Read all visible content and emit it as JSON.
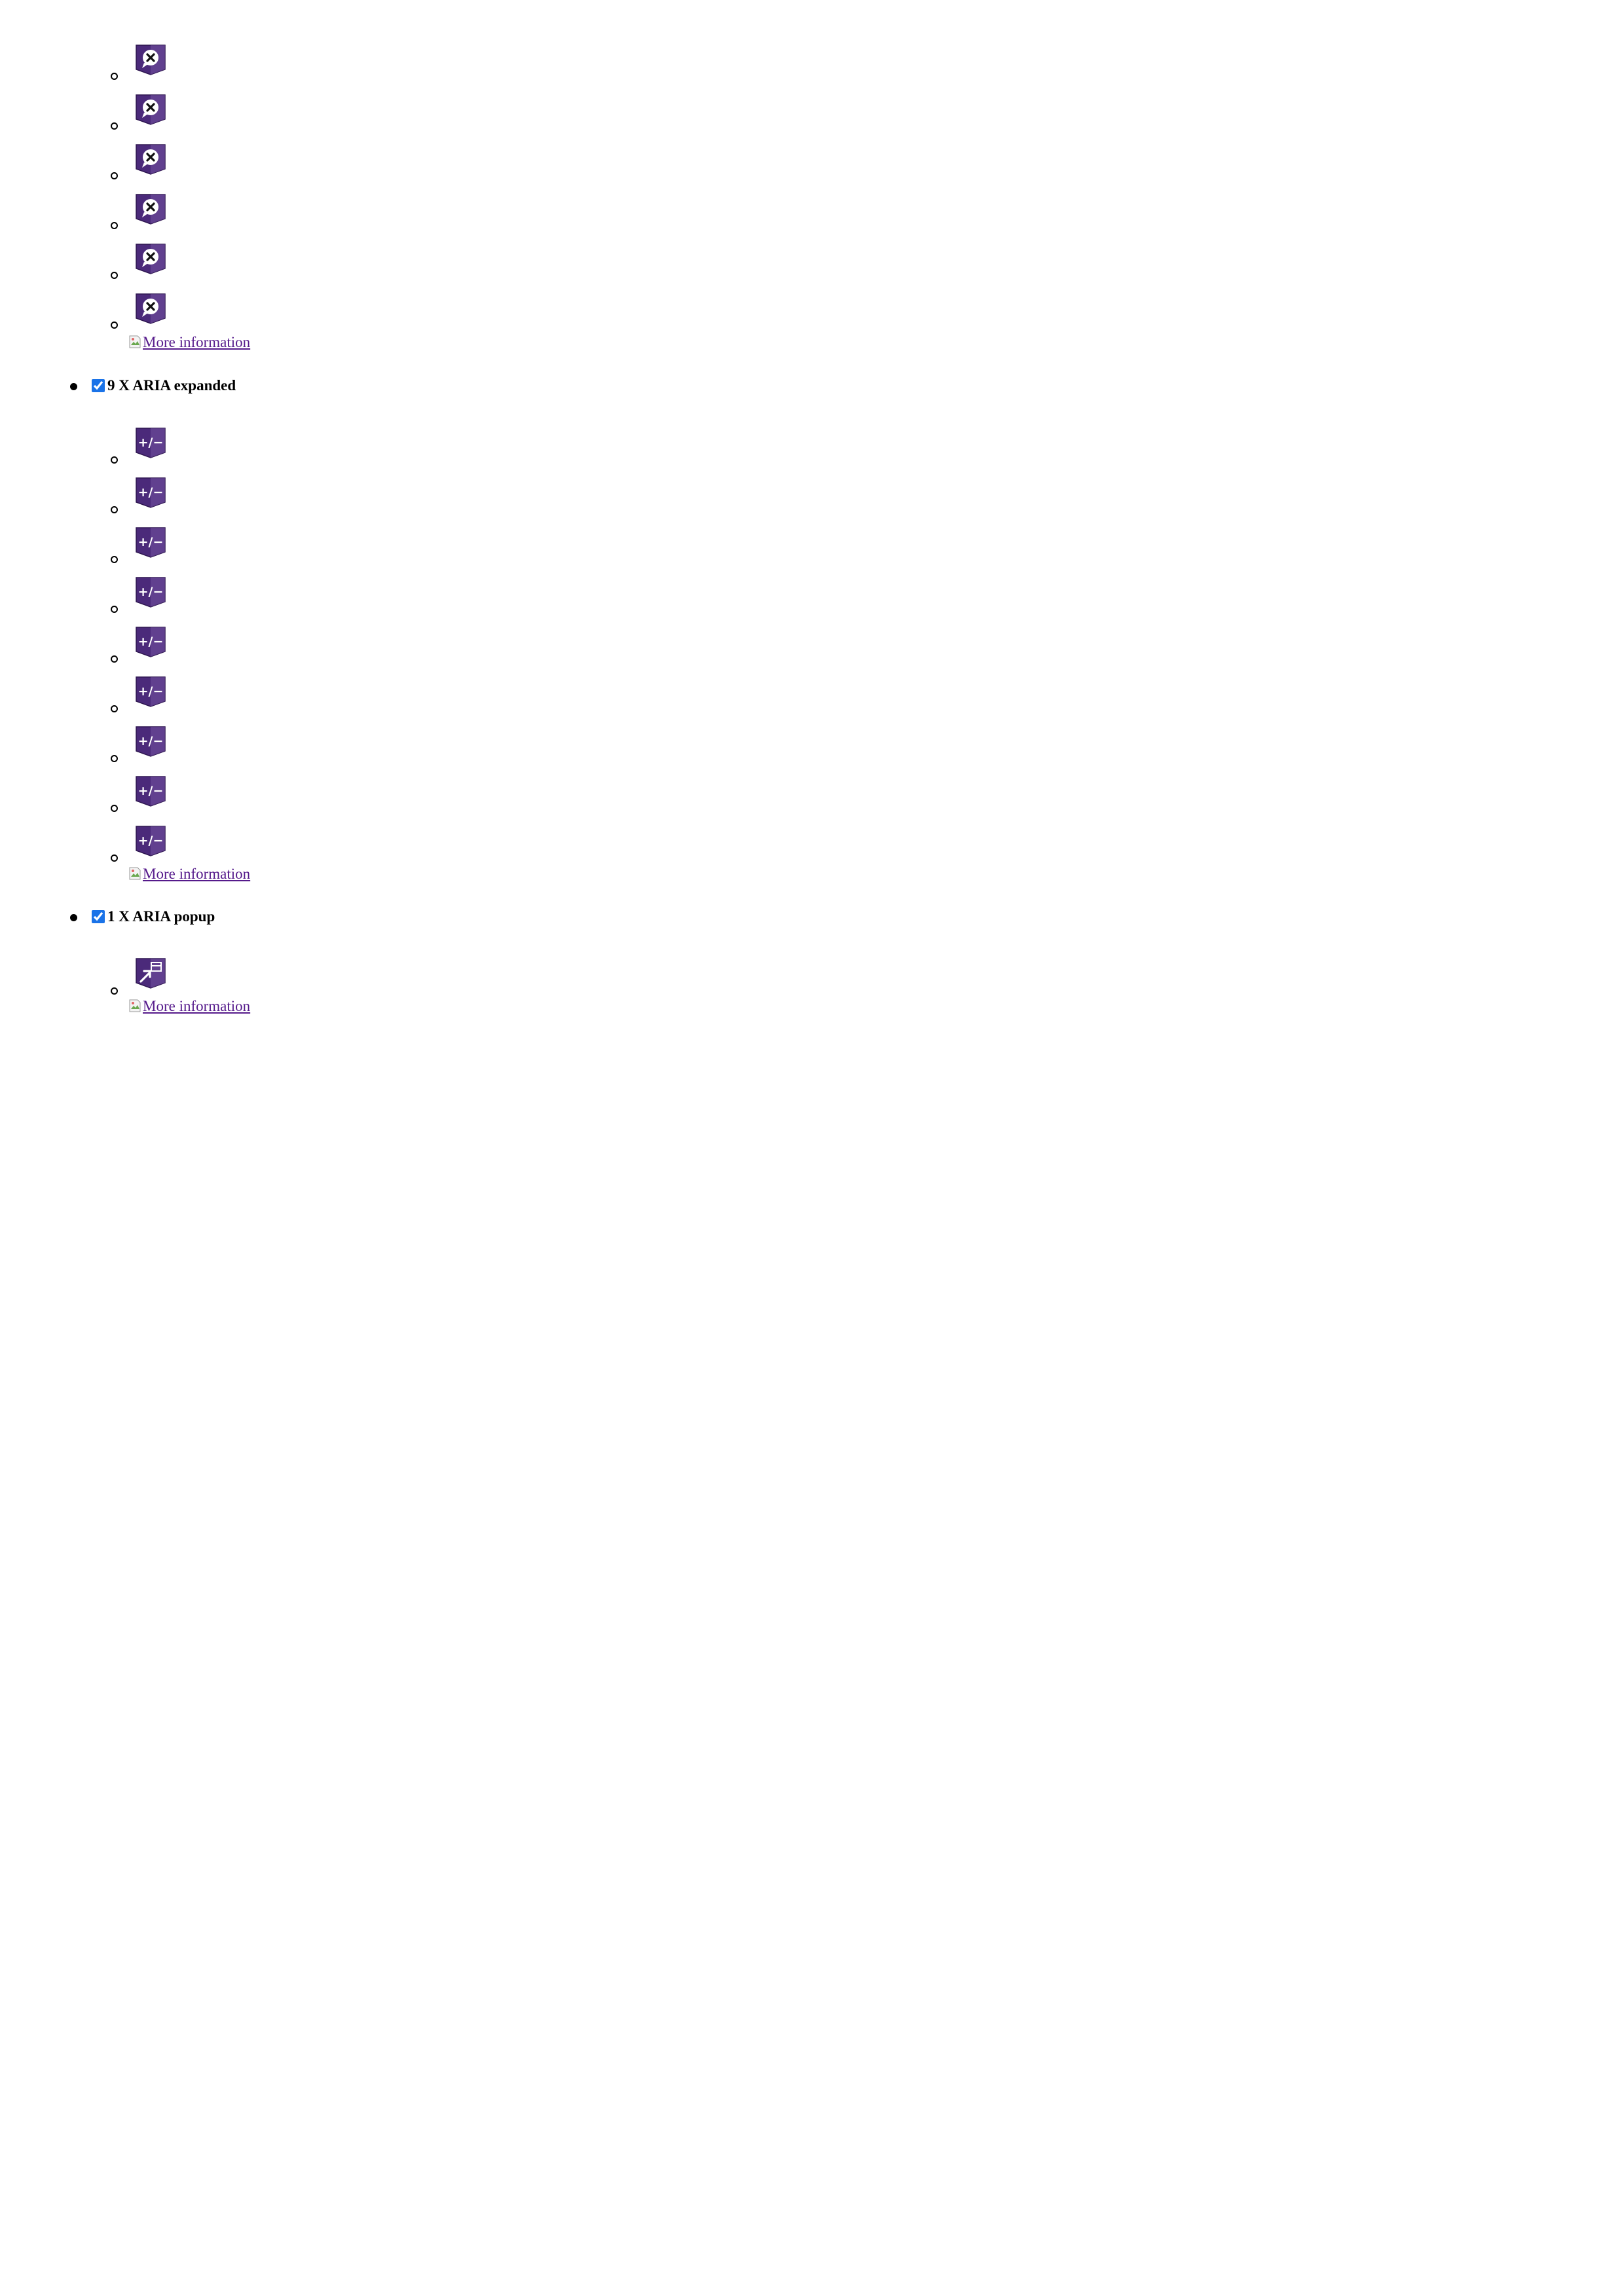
{
  "sections": [
    {
      "heading": "",
      "checked": null,
      "item_icon": "purple-alert-x-icon",
      "item_count": 6,
      "more_link": "More information"
    },
    {
      "heading": "9 X ARIA expanded",
      "checked": true,
      "item_icon": "purple-plus-minus-icon",
      "item_count": 9,
      "more_link": "More information"
    },
    {
      "heading": "1 X ARIA popup",
      "checked": true,
      "item_icon": "purple-popup-icon",
      "item_count": 1,
      "more_link": "More information"
    }
  ],
  "colors": {
    "icon_purple": "#4b2a7a",
    "icon_purple_light": "#7d5aa8",
    "link": "#551a8b",
    "checkbox": "#1a73e8"
  }
}
